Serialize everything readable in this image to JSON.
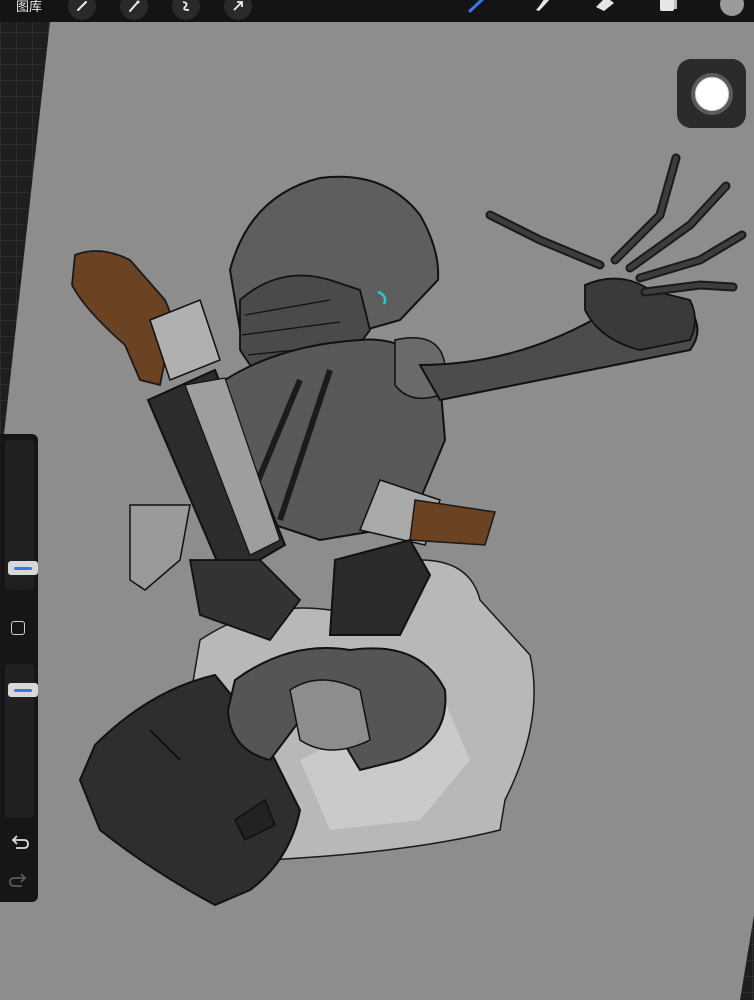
{
  "topbar": {
    "gallery_label": "图库",
    "left_tools": [
      "wrench-icon",
      "magic-wand-icon",
      "selection-icon",
      "transform-icon"
    ],
    "right_tools": [
      "brush-icon",
      "smudge-icon",
      "eraser-icon",
      "layers-icon"
    ],
    "active_tool": "brush-icon",
    "accent_color": "#3a78e8",
    "current_color": "#9a9a9a"
  },
  "canvas": {
    "background_color": "#8d8d8d"
  },
  "sidebar": {
    "brush_size_level": 0.25,
    "opacity_level": 0.85,
    "controls": [
      "brush-size-slider",
      "modify-button",
      "opacity-slider",
      "undo-icon",
      "redo-icon"
    ]
  }
}
